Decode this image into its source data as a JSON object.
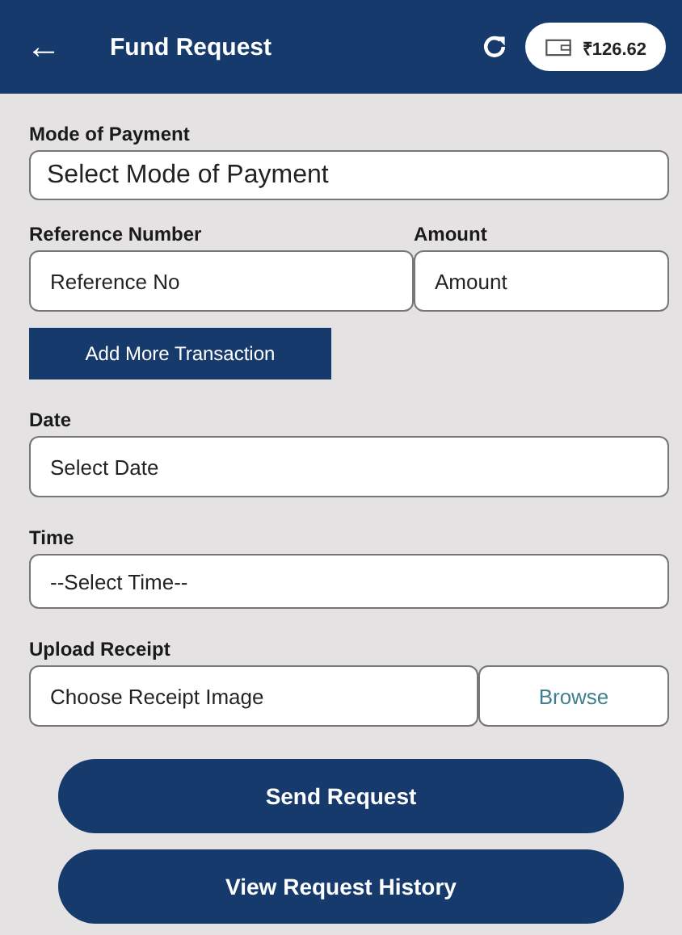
{
  "header": {
    "back": "←",
    "title": "Fund Request",
    "balance": "₹126.62"
  },
  "mode_of_payment": {
    "label": "Mode of Payment",
    "placeholder": "Select Mode of Payment"
  },
  "reference": {
    "label": "Reference Number",
    "placeholder": "Reference No"
  },
  "amount": {
    "label": "Amount",
    "placeholder": "Amount"
  },
  "add_button": "Add More Transaction",
  "date": {
    "label": "Date",
    "placeholder": "Select Date"
  },
  "time": {
    "label": "Time",
    "placeholder": "--Select Time--"
  },
  "upload": {
    "label": "Upload Receipt",
    "placeholder": "Choose Receipt Image",
    "button": "Browse"
  },
  "actions": [
    "Send Request",
    "View Request History"
  ]
}
